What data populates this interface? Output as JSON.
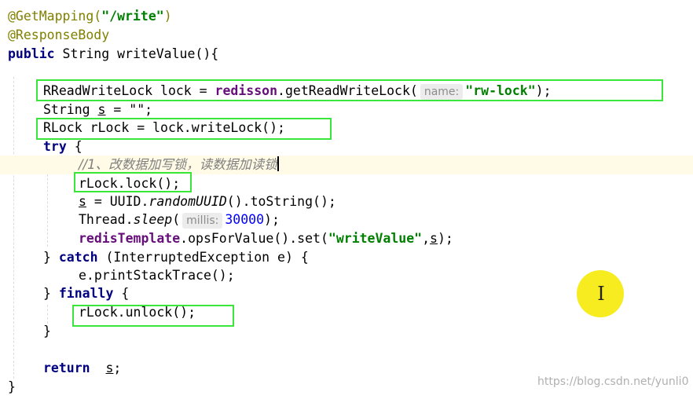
{
  "code": {
    "annotation_mapping": "@GetMapping(",
    "mapping_path": "\"/write\"",
    "annotation_close": ")",
    "annotation_body": "@ResponseBody",
    "public_kw": "public",
    "method_rest": " String writeValue(){",
    "l1_pre": "RReadWriteLock lock = ",
    "l1_field": "redisson",
    "l1_call": ".getReadWriteLock(",
    "l1_hint": "name:",
    "l1_arg": "\"rw-lock\"",
    "l1_end": ");",
    "l2_pre": "String ",
    "l2_var": "s",
    "l2_end": " = \"\";",
    "l3": "RLock rLock = lock.writeLock();",
    "try_kw": "try",
    "try_rest": " {",
    "comment": "//1、改数据加写锁，读数据加读锁",
    "l4": "rLock.lock();",
    "l5_var": "s",
    "l5_mid": " = UUID.",
    "l5_static": "randomUUID",
    "l5_end": "().toString();",
    "l6_pre": "Thread.",
    "l6_static": "sleep",
    "l6_open": "(",
    "l6_hint": "millis:",
    "l6_num": "30000",
    "l6_end": ");",
    "l7_field": "redisTemplate",
    "l7_mid": ".opsForValue().set(",
    "l7_str": "\"writeValue\"",
    "l7_comma": ",",
    "l7_var": "s",
    "l7_end": ");",
    "catch_open": "} ",
    "catch_kw": "catch",
    "catch_rest": " (InterruptedException e) {",
    "l8": "e.printStackTrace();",
    "finally_open": "} ",
    "finally_kw": "finally",
    "finally_rest": " {",
    "l9": "rLock.unlock();",
    "close_inner": "}",
    "return_kw": "return",
    "return_sp": "  ",
    "return_var": "s",
    "return_end": ";",
    "close_outer": "}"
  },
  "watermark": "https://blog.csdn.net/yunli0",
  "colors": {
    "highlight_box": "#39e639",
    "cursor_circle": "#f6ec1f",
    "keyword": "#000080",
    "string": "#008000",
    "annotation": "#808000",
    "field": "#660e7a",
    "number": "#0000ff",
    "comment": "#808080"
  }
}
